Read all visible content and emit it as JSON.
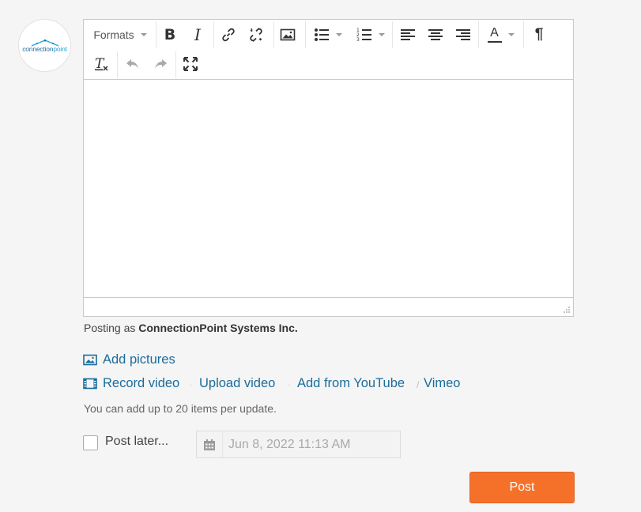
{
  "avatar": {
    "logo_main": "connection",
    "logo_accent": "point"
  },
  "toolbar": {
    "formats_label": "Formats",
    "icons": {
      "bold": "bold-icon",
      "italic": "italic-icon",
      "link": "link-icon",
      "unlink": "unlink-icon",
      "image": "image-icon",
      "bullet_list": "bullet-list-icon",
      "numbered_list": "numbered-list-icon",
      "align_left": "align-left-icon",
      "align_center": "align-center-icon",
      "align_right": "align-right-icon",
      "text_color": "text-color-icon",
      "paragraph": "paragraph-icon",
      "clear_format": "clear-formatting-icon",
      "undo": "undo-icon",
      "redo": "redo-icon",
      "fullscreen": "fullscreen-icon"
    },
    "text_color_glyph": "A",
    "paragraph_glyph": "¶"
  },
  "posting": {
    "prefix": "Posting as",
    "name": "ConnectionPoint Systems Inc."
  },
  "media": {
    "add_pictures": "Add pictures",
    "record_video": "Record video",
    "upload_video": "Upload video",
    "add_from_youtube": "Add from YouTube",
    "slash": "/",
    "vimeo": "Vimeo",
    "dot": "·",
    "limit_note": "You can add up to 20 items per update."
  },
  "schedule": {
    "post_later_label": "Post later...",
    "date_placeholder": "Jun 8, 2022 11:13 AM"
  },
  "actions": {
    "post_label": "Post"
  },
  "colors": {
    "link": "#1b6c9c",
    "post_button": "#f5712a",
    "accent_logo": "#29a6d9"
  }
}
